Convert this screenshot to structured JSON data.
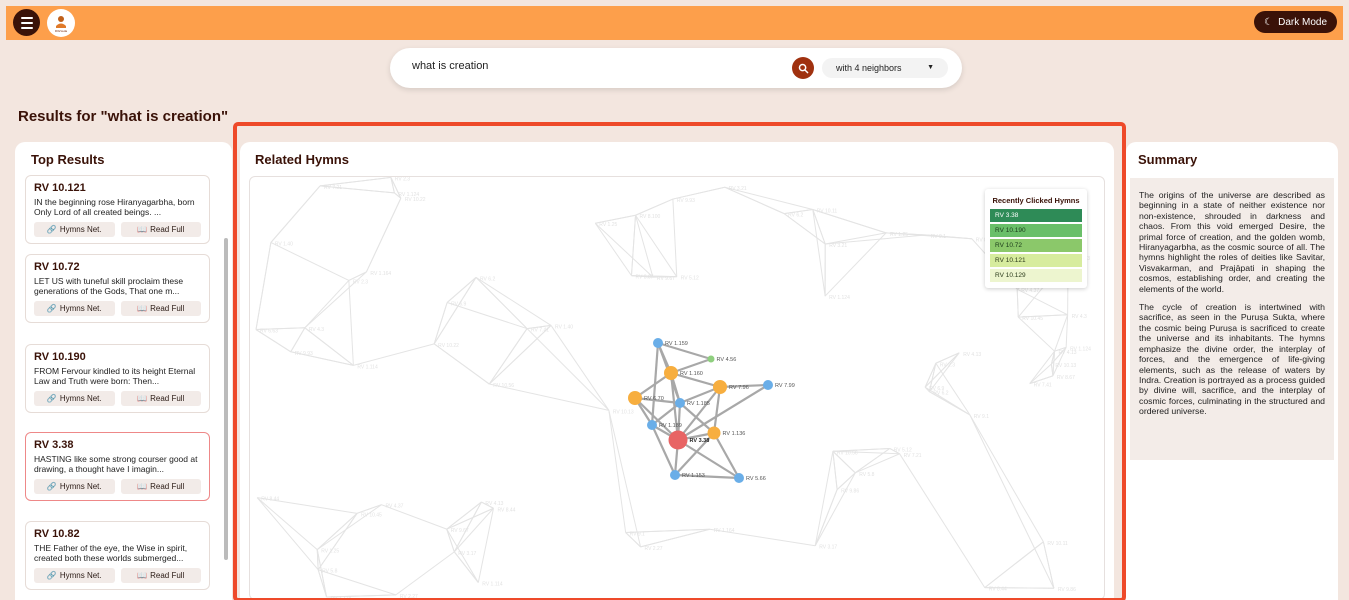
{
  "header": {
    "dark_mode_label": "Dark Mode",
    "logo_text": "RIGVeda"
  },
  "search": {
    "query": "what is creation",
    "neighbors_selected": "with 4 neighbors"
  },
  "results_title": "Results for \"what is creation\"",
  "top_results": {
    "title": "Top Results",
    "items": [
      {
        "id": "RV 10.121",
        "text": "IN the beginning rose Hiranyagarbha, born Only Lord of all created beings. ...",
        "hymns_label": "Hymns Net.",
        "read_label": "Read Full"
      },
      {
        "id": "RV 10.72",
        "text": "LET US with tuneful skill proclaim these generations of the Gods, That one m...",
        "hymns_label": "Hymns Net.",
        "read_label": "Read Full"
      },
      {
        "id": "RV 10.190",
        "text": "FROM Fervour kindled to its height Eternal Law and Truth were born: Then...",
        "hymns_label": "Hymns Net.",
        "read_label": "Read Full"
      },
      {
        "id": "RV 3.38",
        "text": "HASTING like some strong courser good at drawing, a thought have I imagin...",
        "hymns_label": "Hymns Net.",
        "read_label": "Read Full"
      },
      {
        "id": "RV 10.82",
        "text": "THE Father of the eye, the Wise in spirit, created both these worlds submerged...",
        "hymns_label": "Hymns Net.",
        "read_label": "Read Full"
      }
    ]
  },
  "related": {
    "title": "Related Hymns",
    "recent_title": "Recently Clicked Hymns",
    "recent": [
      {
        "label": "RV 3.38",
        "color": "#2e8b57",
        "fg": "#ffffff"
      },
      {
        "label": "RV 10.190",
        "color": "#6abf69",
        "fg": "#1a3a1a"
      },
      {
        "label": "RV 10.72",
        "color": "#8bc86a",
        "fg": "#1a3a1a"
      },
      {
        "label": "RV 10.121",
        "color": "#d7ec9e",
        "fg": "#2a3a1a"
      },
      {
        "label": "RV 10.129",
        "color": "#edf5cf",
        "fg": "#2a3a1a"
      }
    ],
    "nodes": [
      {
        "label": "RV 1.159",
        "color": "#6aaee8"
      },
      {
        "label": "RV 4.56",
        "color": "#8fcf7f"
      },
      {
        "label": "RV 1.160",
        "color": "#f7ae3f"
      },
      {
        "label": "RV 7.96",
        "color": "#f7ae3f"
      },
      {
        "label": "RV 7.99",
        "color": "#6aaee8"
      },
      {
        "label": "RV 6.70",
        "color": "#f7ae3f"
      },
      {
        "label": "RV 1.185",
        "color": "#6aaee8"
      },
      {
        "label": "RV 1.189",
        "color": "#6aaee8"
      },
      {
        "label": "RV 3.38",
        "color": "#e86464"
      },
      {
        "label": "RV 1.136",
        "color": "#f7ae3f"
      },
      {
        "label": "RV 1.153",
        "color": "#6aaee8"
      },
      {
        "label": "RV 5.66",
        "color": "#6aaee8"
      }
    ],
    "background_labels": [
      "RV 9.1",
      "RV 2.3",
      "RV 6.2",
      "RV 1.25",
      "RV 4.13",
      "RV 8.44",
      "RV 10.11",
      "RV 5.12",
      "RV 3.21",
      "RV 7.41",
      "RV 10.22",
      "RV 9.86",
      "RV 1.114",
      "RV 6.63",
      "RV 10.13",
      "RV 1.124",
      "RV 2.27",
      "RV 8.67",
      "RV 10.45",
      "RV 4.37",
      "RV 1.40",
      "RV 5.8",
      "RV 3.17",
      "RV 9.67",
      "RV 1.124",
      "RV 7.21",
      "RV 1.164",
      "RV 8.100",
      "RV 9.93",
      "RV 10.56",
      "RV 4.3",
      "RV 6.9"
    ]
  },
  "summary": {
    "title": "Summary",
    "paragraphs": [
      "The origins of the universe are described as beginning in a state of neither existence nor non-existence, shrouded in darkness and chaos. From this void emerged Desire, the primal force of creation, and the golden womb, Hiranyagarbha, as the cosmic source of all. The hymns highlight the roles of deities like Savitar, Visvakarman, and Prajāpati in shaping the cosmos, establishing order, and creating the elements of the world.",
      "The cycle of creation is intertwined with sacrifice, as seen in the Puruṣa Sukta, where the cosmic being Puruṣa is sacrificed to create the universe and its inhabitants. The hymns emphasize the divine order, the interplay of forces, and the emergence of life-giving elements, such as the release of waters by Indra. Creation is portrayed as a process guided by divine will, sacrifice, and the interplay of cosmic forces, culminating in the structured and ordered universe."
    ]
  }
}
